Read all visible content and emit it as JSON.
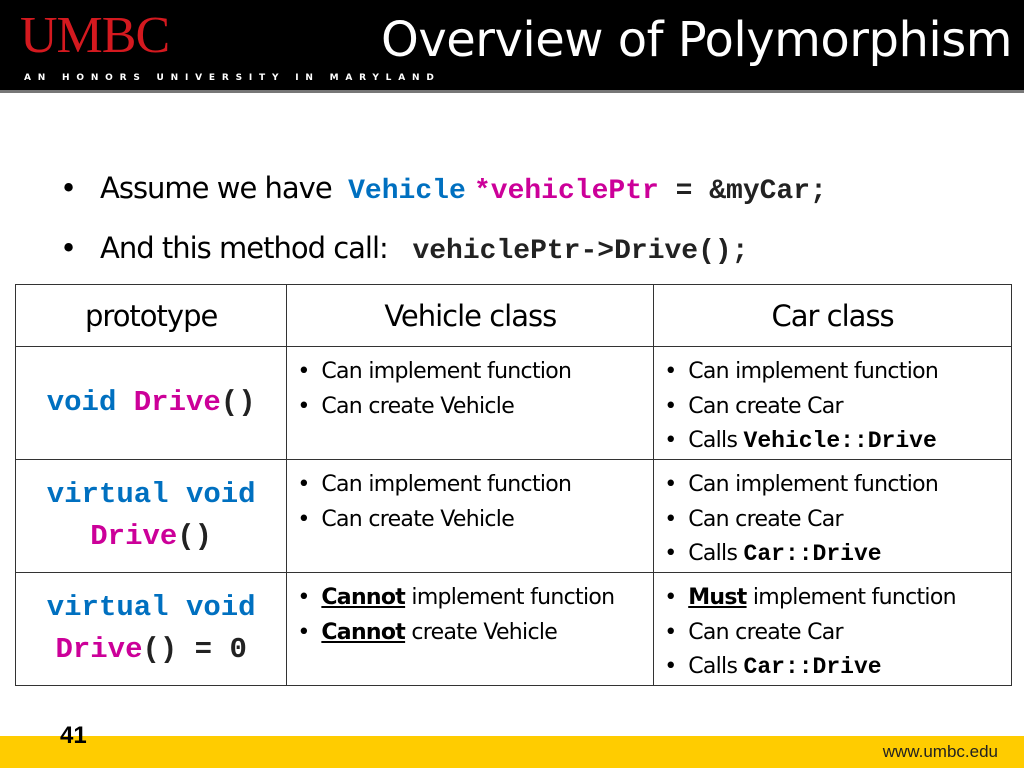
{
  "header": {
    "logo": "UMBC",
    "tagline": "AN HONORS UNIVERSITY IN MARYLAND",
    "title": "Overview of Polymorphism"
  },
  "bullets": [
    {
      "text": "Assume we have",
      "code_type": "Vehicle",
      "code_var": "*vehiclePtr",
      "code_rest": " = &myCar;"
    },
    {
      "text": "And this method call:",
      "code": "vehiclePtr->Drive();"
    }
  ],
  "table": {
    "headers": [
      "prototype",
      "Vehicle class",
      "Car class"
    ],
    "rows": [
      {
        "proto": {
          "kw1": "void",
          "name": "Drive",
          "parens": "()",
          "suffix": ""
        },
        "vehicle": [
          {
            "strong": "",
            "text": "Can implement function"
          },
          {
            "strong": "",
            "text": "Can create Vehicle"
          }
        ],
        "car": [
          {
            "strong": "",
            "text": "Can implement function"
          },
          {
            "strong": "",
            "text": "Can create Car"
          },
          {
            "text": "Calls ",
            "code": "Vehicle::Drive"
          }
        ]
      },
      {
        "proto": {
          "kw1": "virtual void",
          "name": "Drive",
          "parens": "()",
          "suffix": ""
        },
        "vehicle": [
          {
            "strong": "",
            "text": "Can implement function"
          },
          {
            "strong": "",
            "text": "Can create Vehicle"
          }
        ],
        "car": [
          {
            "strong": "",
            "text": "Can implement function"
          },
          {
            "strong": "",
            "text": "Can create Car"
          },
          {
            "text": "Calls ",
            "code": "Car::Drive"
          }
        ]
      },
      {
        "proto": {
          "kw1": "virtual void",
          "name": "Drive",
          "parens": "()",
          "suffix": " = 0"
        },
        "vehicle": [
          {
            "strong": "Cannot",
            "text": " implement function"
          },
          {
            "strong": "Cannot",
            "text": " create Vehicle"
          }
        ],
        "car": [
          {
            "strong": "Must",
            "text": " implement function"
          },
          {
            "strong": "",
            "text": "Can create Car"
          },
          {
            "text": "Calls ",
            "code": "Car::Drive"
          }
        ]
      }
    ]
  },
  "footer": {
    "page_number": "41",
    "url": "www.umbc.edu"
  },
  "colors": {
    "logo_red": "#d4191f",
    "footer_gold": "#ffcc00",
    "code_blue": "#0070c0",
    "code_magenta": "#cc0099"
  }
}
